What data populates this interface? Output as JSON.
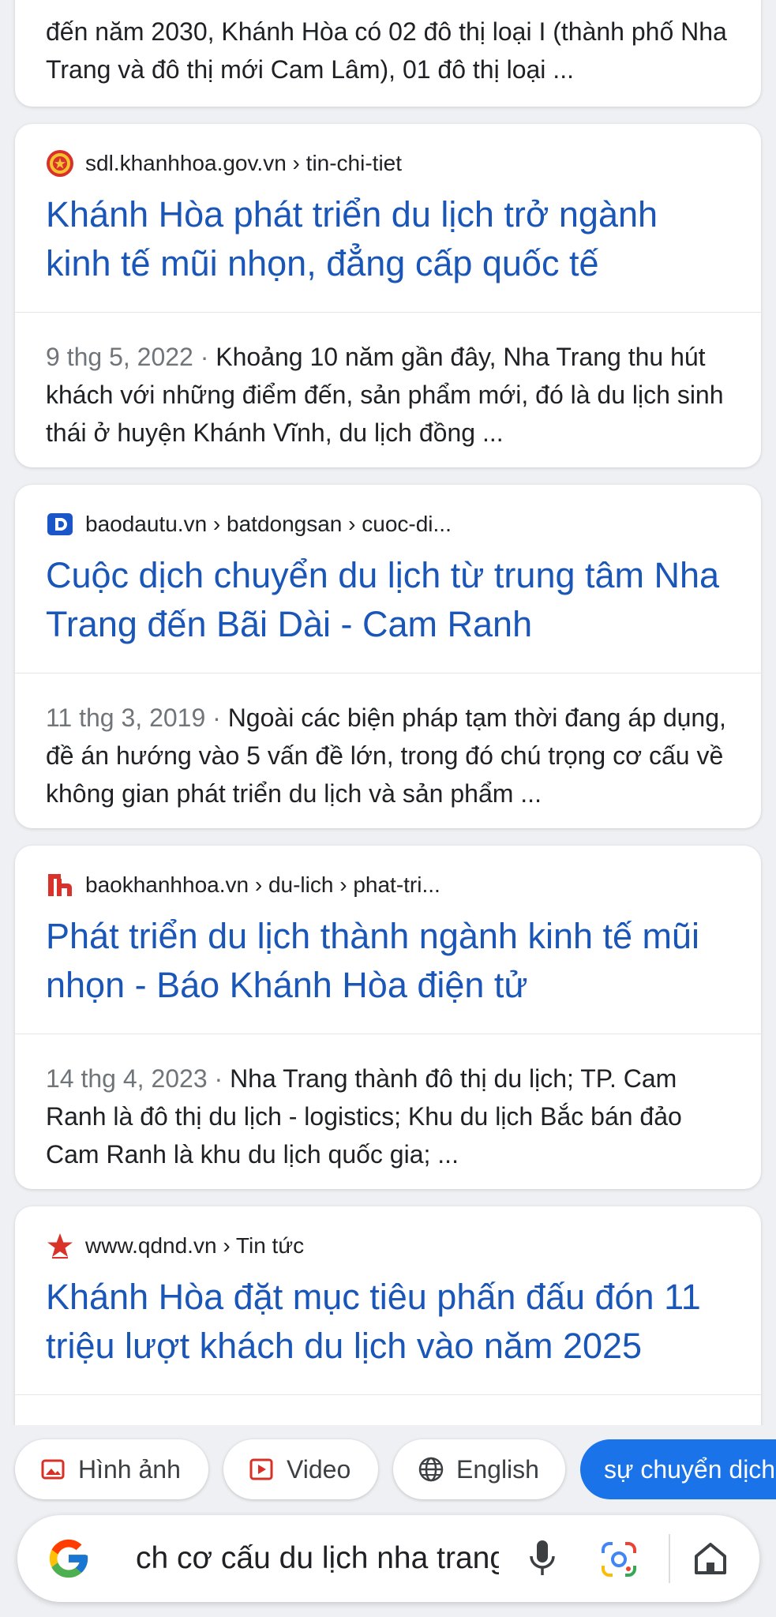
{
  "partial_result": {
    "snippet": "đến năm 2030, Khánh Hòa có 02 đô thị loại I (thành phố Nha Trang và đô thị mới Cam Lâm), 01 đô thị loại ..."
  },
  "results": [
    {
      "site": "sdl.khanhhoa.gov.vn › tin-chi-tiet",
      "favicon": "vietnam-emblem-icon",
      "title": "Khánh Hòa phát triển du lịch trở ngành kinh tế mũi nhọn, đẳng cấp quốc tế",
      "date": "9 thg 5, 2022",
      "snippet": "Khoảng 10 năm gần đây, Nha Trang thu hút khách với những điểm đến, sản phẩm mới, đó là du lịch sinh thái ở huyện Khánh Vĩnh, du lịch đồng ..."
    },
    {
      "site": "baodautu.vn › batdongsan › cuoc-di...",
      "favicon": "baodautu-logo-icon",
      "title": "Cuộc dịch chuyển du lịch từ trung tâm Nha Trang đến Bãi Dài - Cam Ranh",
      "date": "11 thg 3, 2019",
      "snippet": "Ngoài các biện pháp tạm thời đang áp dụng, đề án hướng vào 5 vấn đề lớn, trong đó chú trọng cơ cấu về không gian phát triển du lịch và sản phẩm ..."
    },
    {
      "site": "baokhanhhoa.vn › du-lich › phat-tri...",
      "favicon": "baokhanhhoa-logo-icon",
      "title": "Phát triển du lịch thành ngành kinh tế mũi nhọn - Báo Khánh Hòa điện tử",
      "date": "14 thg 4, 2023",
      "snippet": "Nha Trang thành đô thị du lịch; TP. Cam Ranh là đô thị du lịch - logistics; Khu du lịch Bắc bán đảo Cam Ranh là khu du lịch quốc gia; ..."
    },
    {
      "site": "www.qdnd.vn › Tin tức",
      "favicon": "red-star-icon",
      "title": "Khánh Hòa đặt mục tiêu phấn đấu đón 11 triệu lượt khách du lịch vào năm 2025"
    }
  ],
  "chips": [
    {
      "label": "Hình ảnh",
      "icon": "image-icon"
    },
    {
      "label": "Video",
      "icon": "video-icon"
    },
    {
      "label": "English",
      "icon": "globe-icon"
    },
    {
      "label": "sự chuyển dịch"
    }
  ],
  "search": {
    "query": "ch cơ cấu du lịch nha trang"
  },
  "colors": {
    "title_link": "#1a56b8",
    "accent": "#1a73e8"
  }
}
